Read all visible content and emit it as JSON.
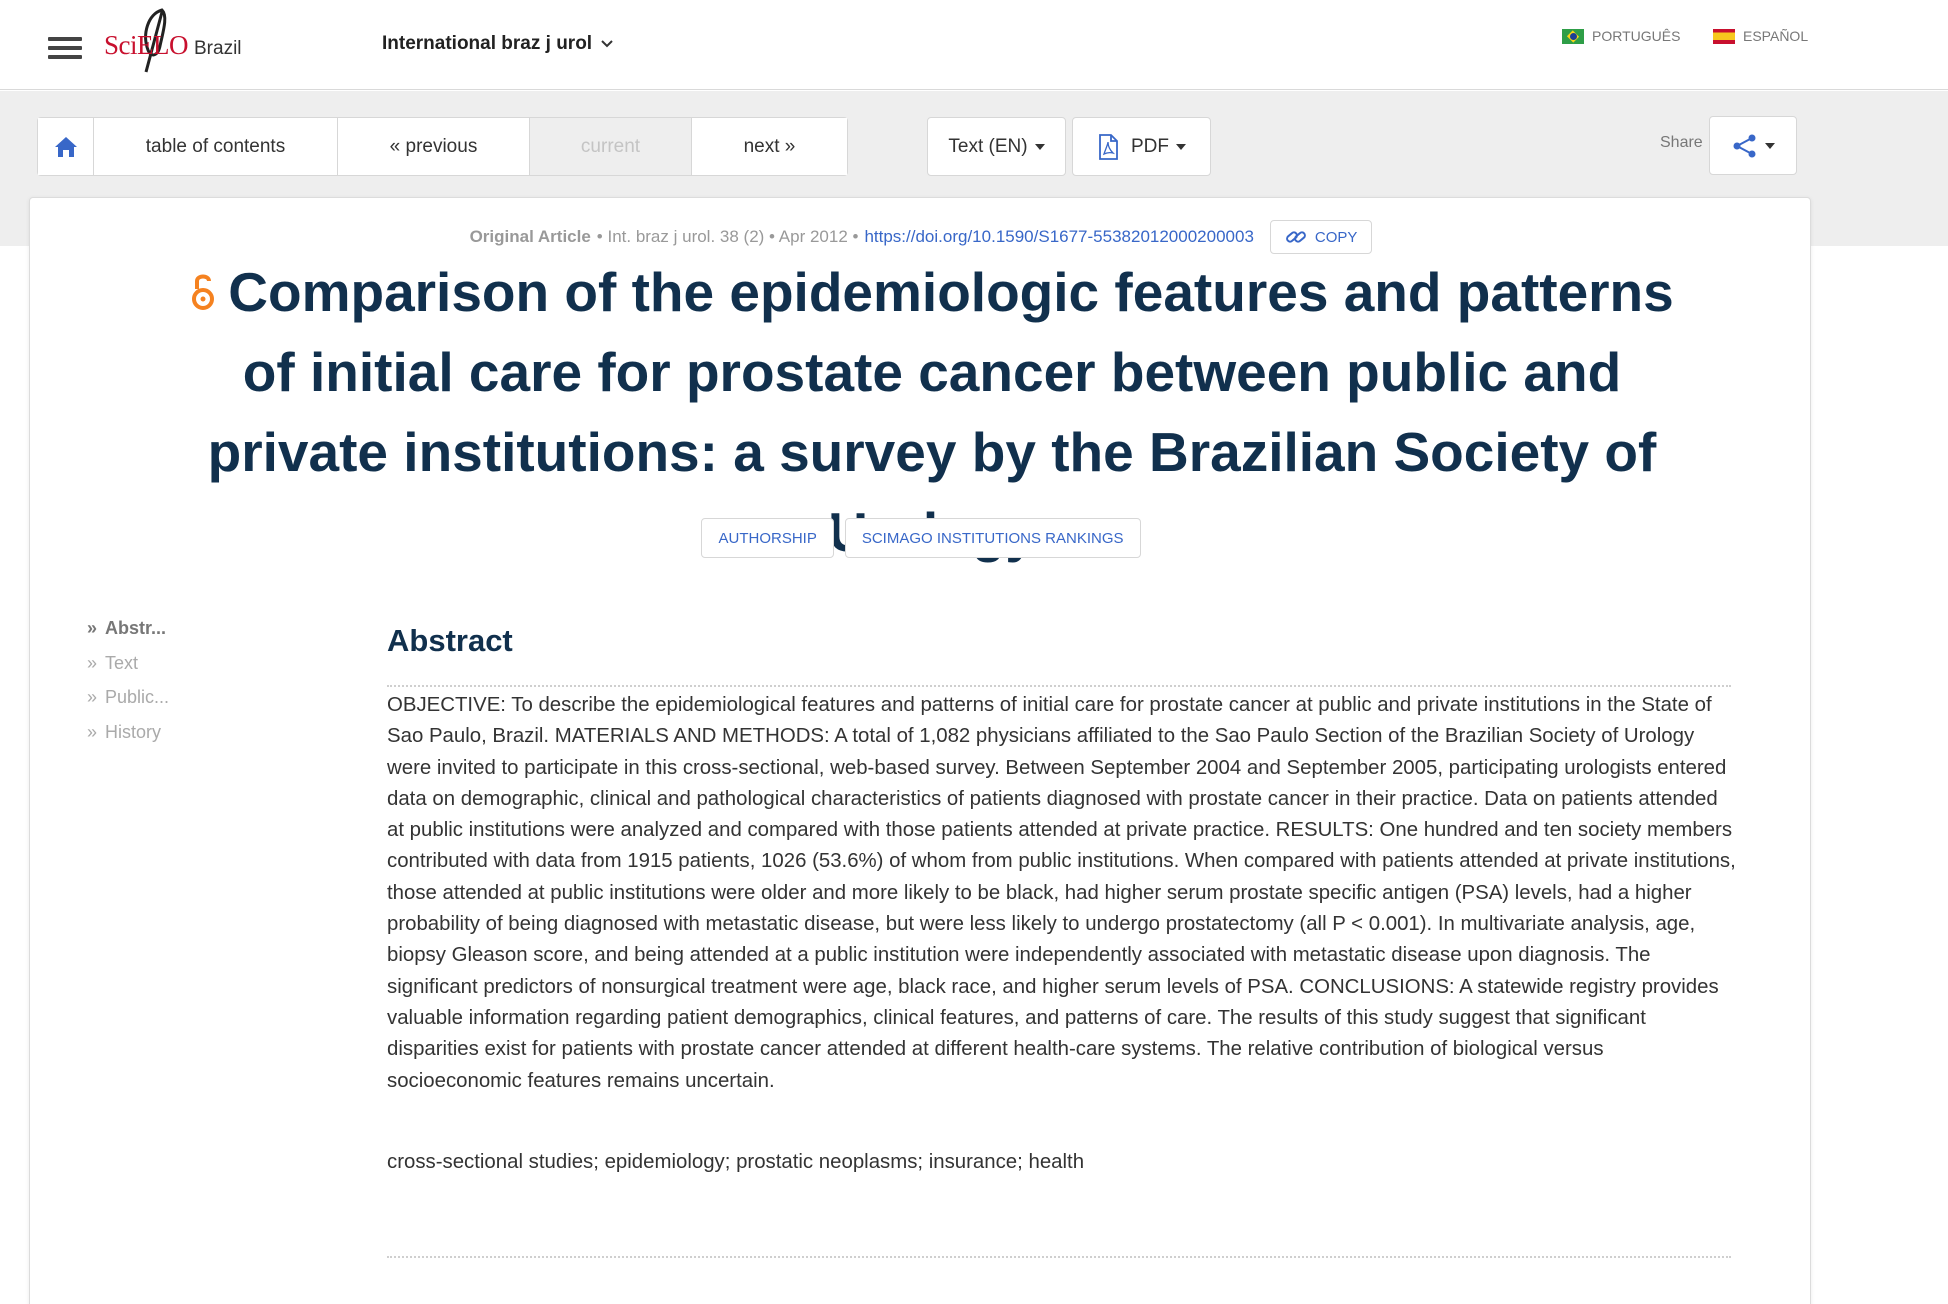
{
  "header": {
    "logo_text": "SciELO",
    "country": "Brazil",
    "journal": "International braz j urol",
    "languages": [
      {
        "label": "PORTUGUÊS"
      },
      {
        "label": "ESPAÑOL"
      }
    ]
  },
  "toolbar": {
    "home_icon": "home-icon",
    "toc_label": "table of contents",
    "previous_label": "« previous",
    "current_label": "current",
    "next_label": "next »",
    "text_label": "Text (EN)",
    "pdf_label": "PDF",
    "share_label": "Share"
  },
  "article": {
    "type": "Original Article",
    "citation": "• Int. braz j urol. 38 (2) • Apr 2012 •",
    "doi": "https://doi.org/10.1590/S1677-55382012000200003",
    "copy_label": "COPY",
    "title": "Comparison of the epidemiologic features and patterns of initial care for prostate cancer between public and private institutions: a survey by the Brazilian Society of Urology",
    "tags": [
      "AUTHORSHIP",
      "SCIMAGO INSTITUTIONS RANKINGS"
    ]
  },
  "sidenav": {
    "items": [
      "Abstr...",
      "Text",
      "Public...",
      "History"
    ]
  },
  "abstract": {
    "heading": "Abstract",
    "body": "OBJECTIVE: To describe the epidemiological features and patterns of initial care for prostate cancer at public and private institutions in the State of Sao Paulo, Brazil. MATERIALS AND METHODS: A total of 1,082 physicians affiliated to the Sao Paulo Section of the Brazilian Society of Urology were invited to participate in this cross-sectional, web-based survey. Between September 2004 and September 2005, participating urologists entered data on demographic, clinical and pathological characteristics of patients diagnosed with prostate cancer in their practice. Data on patients attended at public institutions were analyzed and compared with those patients attended at private practice. RESULTS: One hundred and ten society members contributed with data from 1915 patients, 1026 (53.6%) of whom from public institutions. When compared with patients attended at private institutions, those attended at public institutions were older and more likely to be black, had higher serum prostate specific antigen (PSA) levels, had a higher probability of being diagnosed with metastatic disease, but were less likely to undergo prostatectomy (all P < 0.001). In multivariate analysis, age, biopsy Gleason score, and being attended at a public institution were independently associated with metastatic disease upon diagnosis. The significant predictors of nonsurgical treatment were age, black race, and higher serum levels of PSA. CONCLUSIONS: A statewide registry provides valuable information regarding patient demographics, clinical features, and patterns of care. The results of this study suggest that significant disparities exist for patients with prostate cancer attended at different health-care systems. The relative contribution of biological versus socioeconomic features remains uncertain.",
    "keywords": "cross-sectional studies; epidemiology; prostatic neoplasms; insurance; health"
  },
  "colors": {
    "title": "#11304d",
    "link": "#3867c8",
    "open_access": "#f58220",
    "logo_red": "#c8102e"
  }
}
